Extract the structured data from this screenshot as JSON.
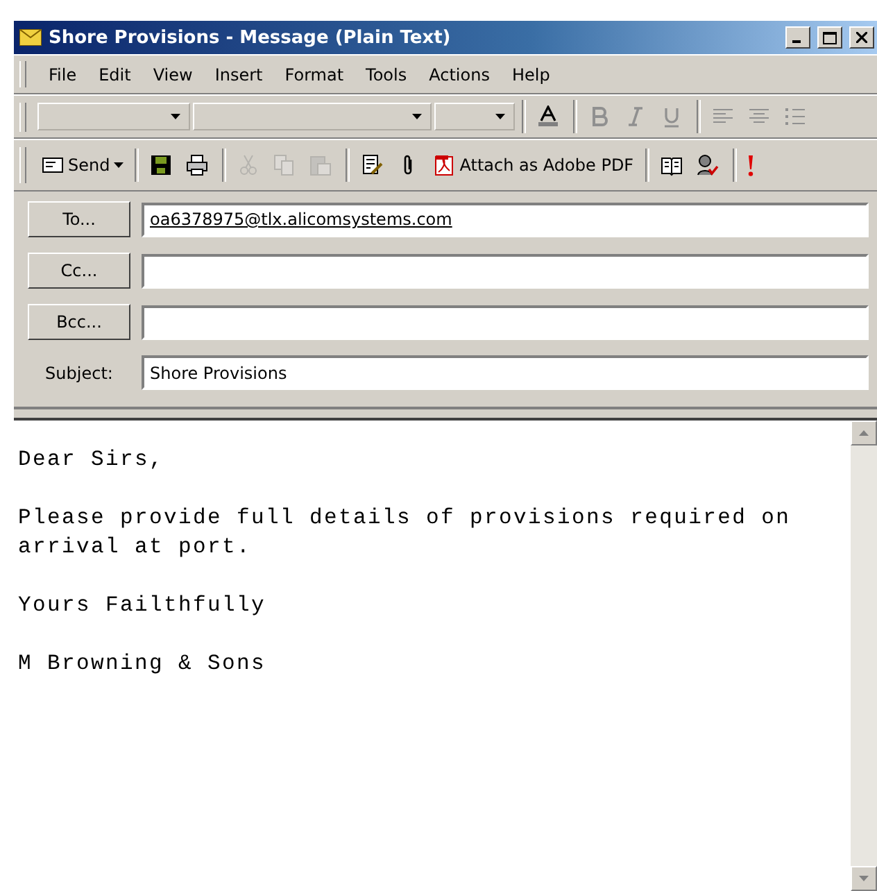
{
  "window": {
    "title": "Shore Provisions - Message (Plain Text)"
  },
  "menu": [
    "File",
    "Edit",
    "View",
    "Insert",
    "Format",
    "Tools",
    "Actions",
    "Help"
  ],
  "format_toolbar": [
    {
      "kind": "dropdown",
      "disabled": false
    },
    {
      "kind": "dropdown",
      "disabled": false
    },
    {
      "kind": "dropdown",
      "disabled": false
    },
    {
      "kind": "font-color",
      "disabled": false
    },
    {
      "kind": "bold",
      "disabled": true
    },
    {
      "kind": "italic",
      "disabled": true
    },
    {
      "kind": "underline",
      "disabled": true
    },
    {
      "kind": "align-left",
      "disabled": true
    },
    {
      "kind": "align-center",
      "disabled": true
    },
    {
      "kind": "bullets",
      "disabled": true
    }
  ],
  "standard_toolbar": [
    {
      "kind": "send",
      "label": "Send",
      "disabled": false
    },
    {
      "kind": "save",
      "disabled": false
    },
    {
      "kind": "print",
      "disabled": false
    },
    {
      "kind": "cut",
      "disabled": true
    },
    {
      "kind": "copy",
      "disabled": true
    },
    {
      "kind": "paste",
      "disabled": true
    },
    {
      "kind": "edit",
      "disabled": false
    },
    {
      "kind": "attach",
      "disabled": false
    },
    {
      "kind": "pdf",
      "label": "Attach as Adobe PDF",
      "disabled": false
    },
    {
      "kind": "address-book",
      "disabled": false
    },
    {
      "kind": "check-names",
      "disabled": false
    },
    {
      "kind": "importance",
      "disabled": false
    }
  ],
  "header_fields": [
    {
      "kind": "recipient",
      "label": "To...",
      "value": "oa6378975@tlx.alicomsystems.com"
    },
    {
      "kind": "recipient",
      "label": "Cc..."
    },
    {
      "kind": "recipient",
      "label": "Bcc..."
    },
    {
      "kind": "subject",
      "label": "Subject:",
      "value": "Shore Provisions"
    }
  ],
  "body": [
    "Dear Sirs,",
    "Please provide full details of provisions required on arrival at port.",
    "Yours Failthfully",
    "M Browning & Sons"
  ]
}
